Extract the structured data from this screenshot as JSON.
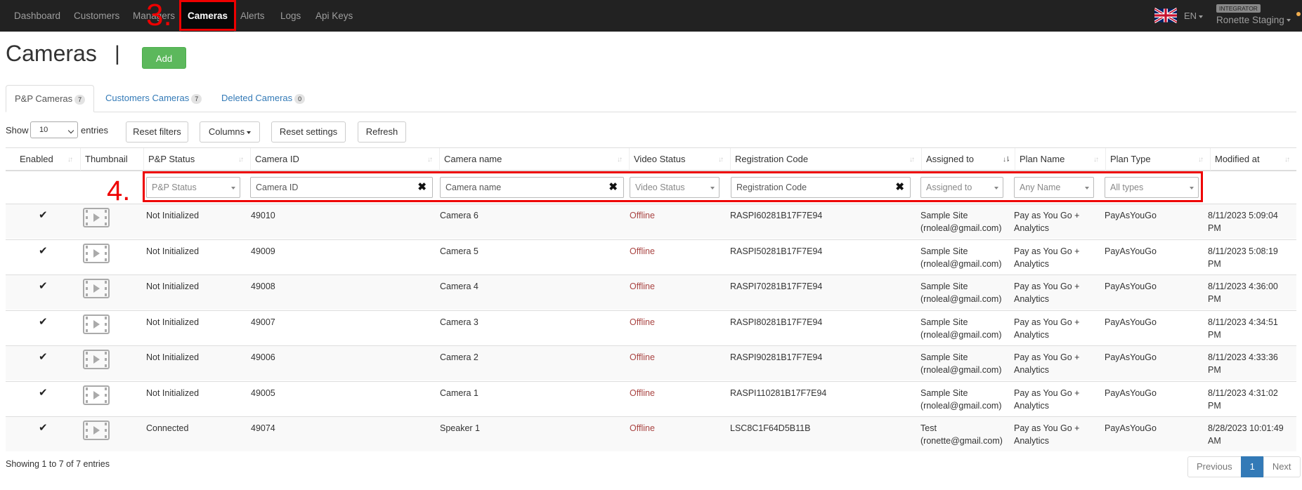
{
  "nav": {
    "items": [
      "Dashboard",
      "Customers",
      "Managers",
      "Cameras",
      "Alerts",
      "Logs",
      "Api Keys"
    ],
    "active": "Cameras",
    "lang": "EN",
    "role_badge": "INTEGRATOR",
    "account": "Ronette Staging",
    "annotation_nav": "3."
  },
  "header": {
    "title": "Cameras",
    "separator": "|",
    "add_label": "Add"
  },
  "tabs": [
    {
      "label": "P&P Cameras",
      "count": "7",
      "active": true
    },
    {
      "label": "Customers Cameras",
      "count": "7",
      "active": false
    },
    {
      "label": "Deleted Cameras",
      "count": "0",
      "active": false
    }
  ],
  "controls": {
    "show_label": "Show",
    "page_size": "10",
    "entries_label": "entries",
    "reset_filters": "Reset filters",
    "columns": "Columns",
    "reset_settings": "Reset settings",
    "refresh": "Refresh"
  },
  "table": {
    "columns": [
      "Enabled",
      "Thumbnail",
      "P&P Status",
      "Camera ID",
      "Camera name",
      "Video Status",
      "Registration Code",
      "Assigned to",
      "Plan Name",
      "Plan Type",
      "Modified at"
    ],
    "filters": {
      "pp_status": "P&P Status",
      "camera_id": "Camera ID",
      "camera_name": "Camera name",
      "video_status": "Video Status",
      "registration_code": "Registration Code",
      "assigned_to": "Assigned to",
      "plan_name": "Any Name",
      "plan_type": "All types"
    },
    "annotation_filters": "4.",
    "rows": [
      {
        "status": "Not Initialized",
        "id": "49010",
        "name": "Camera 6",
        "video": "Offline",
        "reg": "RASPI60281B17F7E94",
        "assigned1": "Sample Site",
        "assigned2": "(rnoleal@gmail.com)",
        "plan1": "Pay as You Go +",
        "plan2": "Analytics",
        "type": "PayAsYouGo",
        "mod1": "8/11/2023 5:09:04",
        "mod2": "PM"
      },
      {
        "status": "Not Initialized",
        "id": "49009",
        "name": "Camera 5",
        "video": "Offline",
        "reg": "RASPI50281B17F7E94",
        "assigned1": "Sample Site",
        "assigned2": "(rnoleal@gmail.com)",
        "plan1": "Pay as You Go +",
        "plan2": "Analytics",
        "type": "PayAsYouGo",
        "mod1": "8/11/2023 5:08:19",
        "mod2": "PM"
      },
      {
        "status": "Not Initialized",
        "id": "49008",
        "name": "Camera 4",
        "video": "Offline",
        "reg": "RASPI70281B17F7E94",
        "assigned1": "Sample Site",
        "assigned2": "(rnoleal@gmail.com)",
        "plan1": "Pay as You Go +",
        "plan2": "Analytics",
        "type": "PayAsYouGo",
        "mod1": "8/11/2023 4:36:00",
        "mod2": "PM"
      },
      {
        "status": "Not Initialized",
        "id": "49007",
        "name": "Camera 3",
        "video": "Offline",
        "reg": "RASPI80281B17F7E94",
        "assigned1": "Sample Site",
        "assigned2": "(rnoleal@gmail.com)",
        "plan1": "Pay as You Go +",
        "plan2": "Analytics",
        "type": "PayAsYouGo",
        "mod1": "8/11/2023 4:34:51",
        "mod2": "PM"
      },
      {
        "status": "Not Initialized",
        "id": "49006",
        "name": "Camera 2",
        "video": "Offline",
        "reg": "RASPI90281B17F7E94",
        "assigned1": "Sample Site",
        "assigned2": "(rnoleal@gmail.com)",
        "plan1": "Pay as You Go +",
        "plan2": "Analytics",
        "type": "PayAsYouGo",
        "mod1": "8/11/2023 4:33:36",
        "mod2": "PM"
      },
      {
        "status": "Not Initialized",
        "id": "49005",
        "name": "Camera 1",
        "video": "Offline",
        "reg": "RASPI110281B17F7E94",
        "assigned1": "Sample Site",
        "assigned2": "(rnoleal@gmail.com)",
        "plan1": "Pay as You Go +",
        "plan2": "Analytics",
        "type": "PayAsYouGo",
        "mod1": "8/11/2023 4:31:02",
        "mod2": "PM"
      },
      {
        "status": "Connected",
        "id": "49074",
        "name": "Speaker 1",
        "video": "Offline",
        "reg": "LSC8C1F64D5B11B",
        "assigned1": "Test",
        "assigned2": "(ronette@gmail.com)",
        "plan1": "Pay as You Go +",
        "plan2": "Analytics",
        "type": "PayAsYouGo",
        "mod1": "8/28/2023 10:01:49",
        "mod2": "AM"
      }
    ]
  },
  "footer": {
    "info": "Showing 1 to 7 of 7 entries",
    "prev": "Previous",
    "page": "1",
    "next": "Next"
  },
  "colors": {
    "navbar": "#222222",
    "add_button": "#5cb85c",
    "link": "#337ab7",
    "offline": "#a94442",
    "annotation": "#ee0000"
  },
  "icons": {
    "enabled": "checkmark-icon",
    "thumbnail": "video-thumbnail-icon",
    "clear": "clear-x-icon",
    "flag": "uk-flag-icon"
  }
}
